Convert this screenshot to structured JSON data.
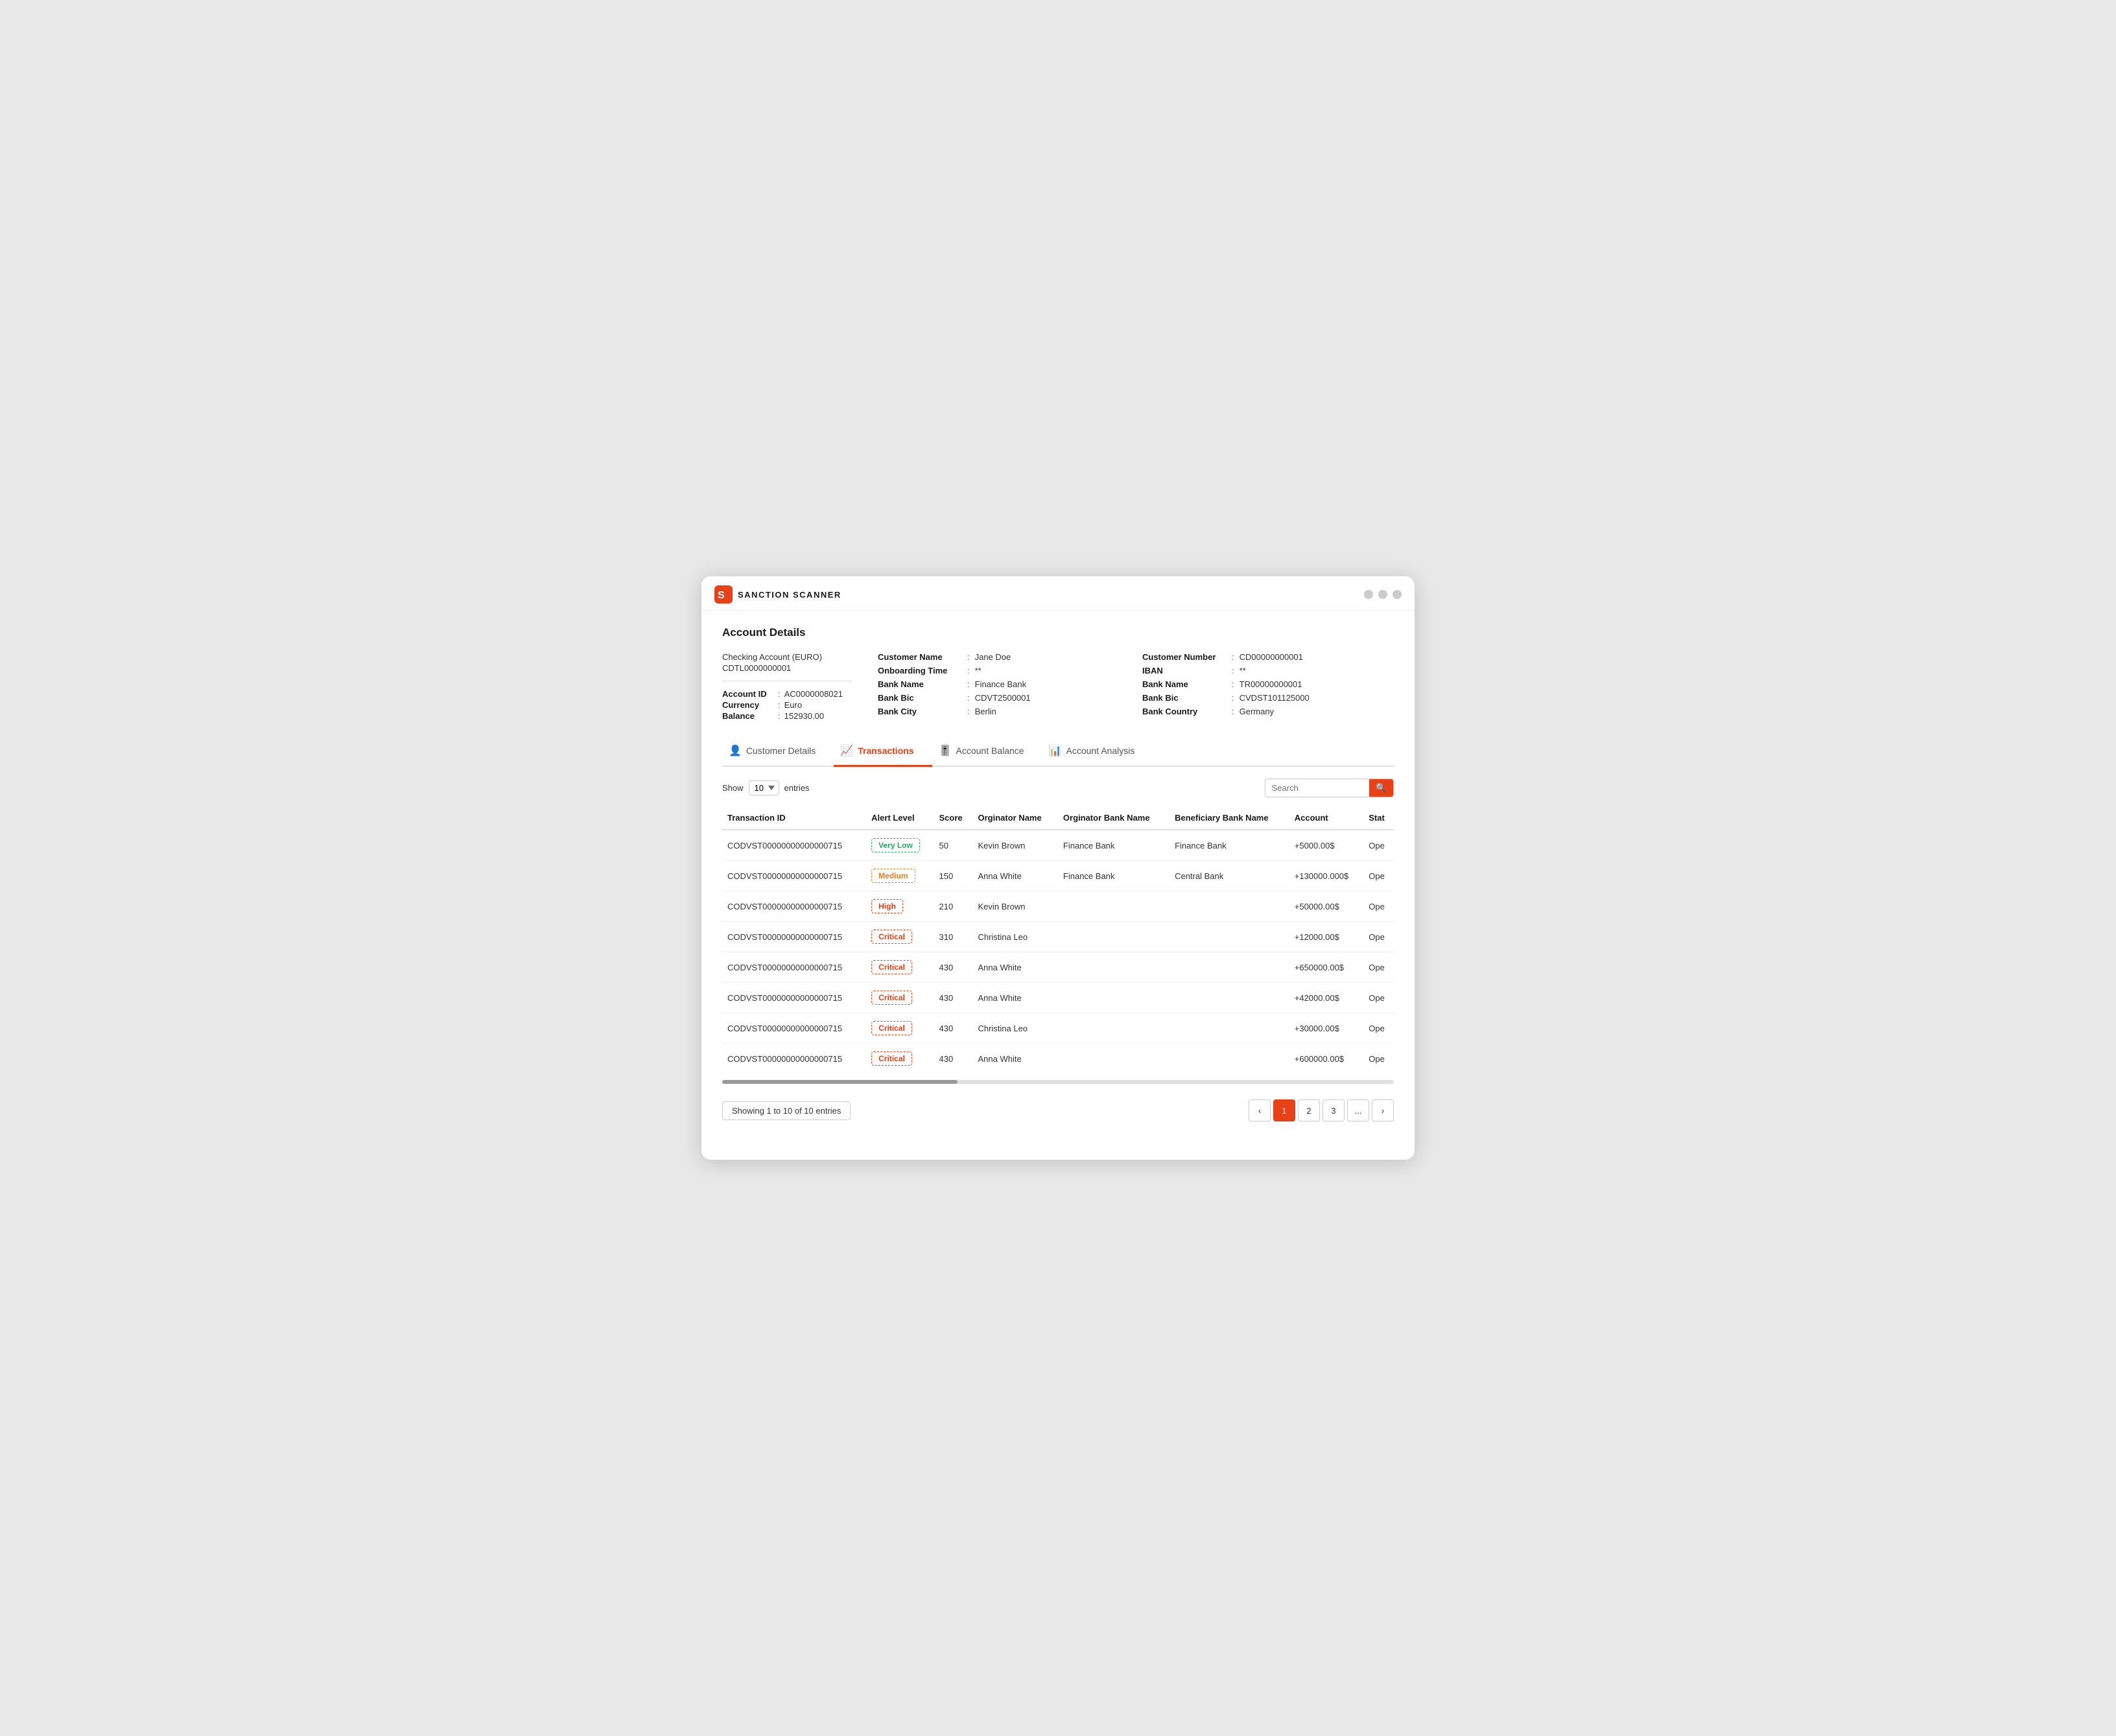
{
  "app": {
    "name": "SANCTION SCANNER"
  },
  "page": {
    "title": "Account Details"
  },
  "account": {
    "type": "Checking Account (EURO)",
    "code": "CDTL0000000001",
    "id_label": "Account ID",
    "id_colon": ":",
    "id_value": "AC0000008021",
    "currency_label": "Currency",
    "currency_colon": ":",
    "currency_value": "Euro",
    "balance_label": "Balance",
    "balance_colon": ":",
    "balance_value": "152930.00"
  },
  "customer_section": {
    "customer_name_label": "Customer Name",
    "customer_name_colon": ":",
    "customer_name_value": "Jane Doe",
    "onboarding_label": "Onboarding Time",
    "onboarding_colon": ":",
    "onboarding_value": "**",
    "bank_name_label": "Bank Name",
    "bank_name_colon": ":",
    "bank_name_value": "Finance Bank",
    "bank_bic_label": "Bank Bic",
    "bank_bic_colon": ":",
    "bank_bic_value": "CDVT2500001",
    "bank_city_label": "Bank City",
    "bank_city_colon": ":",
    "bank_city_value": "Berlin"
  },
  "right_section": {
    "customer_number_label": "Customer Number",
    "customer_number_colon": ":",
    "customer_number_value": "CD00000000001",
    "iban_label": "IBAN",
    "iban_colon": ":",
    "iban_value": "**",
    "bank_name_label": "Bank Name",
    "bank_name_colon": ":",
    "bank_name_value": "TR00000000001",
    "bank_bic_label": "Bank Bic",
    "bank_bic_colon": ":",
    "bank_bic_value": "CVDST101125000",
    "bank_country_label": "Bank Country",
    "bank_country_colon": ":",
    "bank_country_value": "Germany"
  },
  "tabs": [
    {
      "id": "customer-details",
      "icon": "👤",
      "label": "Customer Details",
      "active": false
    },
    {
      "id": "transactions",
      "icon": "📈",
      "label": "Transactions",
      "active": true
    },
    {
      "id": "account-balance",
      "icon": "🎚️",
      "label": "Account Balance",
      "active": false
    },
    {
      "id": "account-analysis",
      "icon": "📊",
      "label": "Account Analysis",
      "active": false
    }
  ],
  "table_controls": {
    "show_label": "Show",
    "entries_value": "10",
    "entries_label": "entries",
    "search_placeholder": "Search"
  },
  "table": {
    "columns": [
      "Transaction ID",
      "Alert Level",
      "Score",
      "Orginator Name",
      "Orginator Bank Name",
      "Beneficiary Bank Name",
      "Account",
      "Stat"
    ],
    "rows": [
      {
        "id": "CODVST00000000000000715",
        "alert": "Very Low",
        "alert_class": "badge-very-low",
        "score": "50",
        "originator": "Kevin Brown",
        "orig_bank": "Finance Bank",
        "benef_bank": "Finance Bank",
        "account": "+5000.00$",
        "status": "Ope"
      },
      {
        "id": "CODVST00000000000000715",
        "alert": "Medium",
        "alert_class": "badge-medium",
        "score": "150",
        "originator": "Anna White",
        "orig_bank": "Finance Bank",
        "benef_bank": "Central Bank",
        "account": "+130000.000$",
        "status": "Ope"
      },
      {
        "id": "CODVST00000000000000715",
        "alert": "High",
        "alert_class": "badge-high",
        "score": "210",
        "originator": "Kevin Brown",
        "orig_bank": "",
        "benef_bank": "",
        "account": "+50000.00$",
        "status": "Ope"
      },
      {
        "id": "CODVST00000000000000715",
        "alert": "Critical",
        "alert_class": "badge-critical",
        "score": "310",
        "originator": "Christina Leo",
        "orig_bank": "",
        "benef_bank": "",
        "account": "+12000.00$",
        "status": "Ope"
      },
      {
        "id": "CODVST00000000000000715",
        "alert": "Critical",
        "alert_class": "badge-critical",
        "score": "430",
        "originator": "Anna White",
        "orig_bank": "",
        "benef_bank": "",
        "account": "+650000.00$",
        "status": "Ope"
      },
      {
        "id": "CODVST00000000000000715",
        "alert": "Critical",
        "alert_class": "badge-critical",
        "score": "430",
        "originator": "Anna White",
        "orig_bank": "",
        "benef_bank": "",
        "account": "+42000.00$",
        "status": "Ope"
      },
      {
        "id": "CODVST00000000000000715",
        "alert": "Critical",
        "alert_class": "badge-critical",
        "score": "430",
        "originator": "Christina Leo",
        "orig_bank": "",
        "benef_bank": "",
        "account": "+30000.00$",
        "status": "Ope"
      },
      {
        "id": "CODVST00000000000000715",
        "alert": "Critical",
        "alert_class": "badge-critical",
        "score": "430",
        "originator": "Anna White",
        "orig_bank": "",
        "benef_bank": "",
        "account": "+600000.00$",
        "status": "Ope"
      }
    ]
  },
  "footer": {
    "showing_text": "Showing 1 to 10 of 10 entries",
    "pages": [
      "1",
      "2",
      "3",
      "..."
    ],
    "current_page": "1"
  }
}
